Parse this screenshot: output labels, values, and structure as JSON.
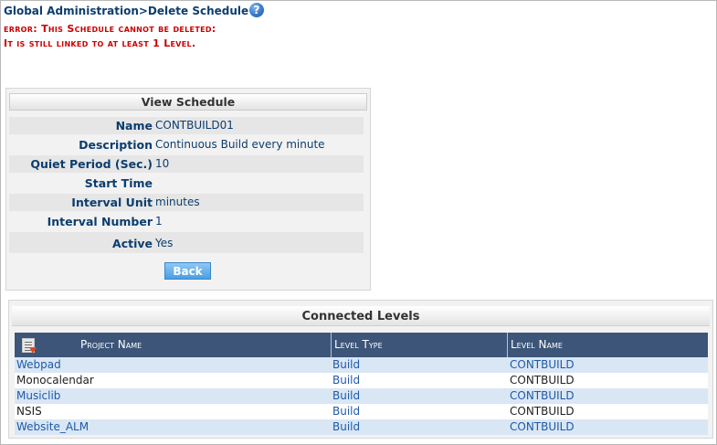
{
  "breadcrumb": "Global Administration>Delete Schedule",
  "error": {
    "line1": "error: This Schedule cannot be deleted:",
    "line2": "It is still linked to at least 1 Level."
  },
  "view_schedule": {
    "title": "View Schedule",
    "fields": [
      {
        "label": "Name",
        "value": "CONTBUILD01"
      },
      {
        "label": "Description",
        "value": "Continuous Build every minute"
      },
      {
        "label": "Quiet Period (Sec.)",
        "value": "10"
      },
      {
        "label": "Start Time",
        "value": ""
      },
      {
        "label": "Interval Unit",
        "value": "minutes"
      },
      {
        "label": "Interval Number",
        "value": "1"
      },
      {
        "label": "Active",
        "value": "Yes"
      }
    ],
    "back_label": "Back"
  },
  "connected_levels": {
    "title": "Connected Levels",
    "columns": [
      "Project Name",
      "Level Type",
      "Level Name"
    ],
    "rows": [
      {
        "project": "Webpad",
        "type": "Build",
        "name": "CONTBUILD"
      },
      {
        "project": "Monocalendar",
        "type": "Build",
        "name": "CONTBUILD"
      },
      {
        "project": "Musiclib",
        "type": "Build",
        "name": "CONTBUILD"
      },
      {
        "project": "NSIS",
        "type": "Build",
        "name": "CONTBUILD"
      },
      {
        "project": "Website_ALM",
        "type": "Build",
        "name": "CONTBUILD"
      }
    ]
  },
  "colors": {
    "header_bg": "#3c5578",
    "row_alt": "#d9e6f4",
    "error": "#cc0000",
    "link": "#1f5aa8"
  }
}
